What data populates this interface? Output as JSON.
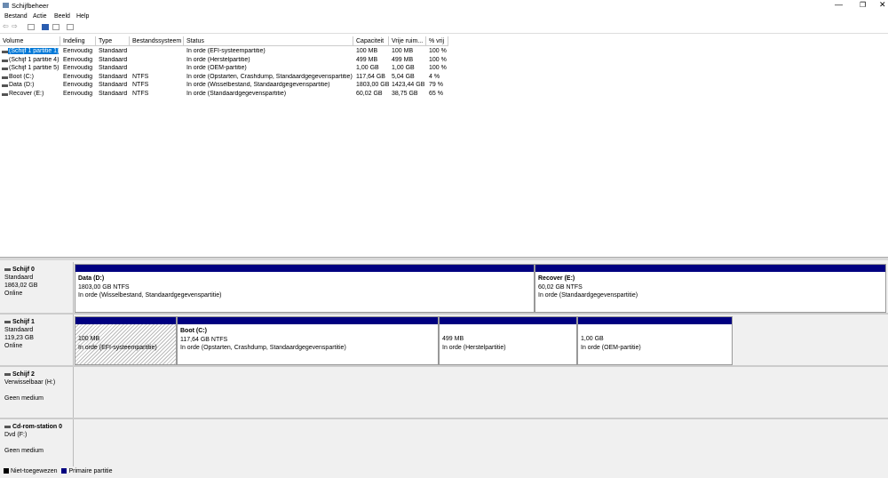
{
  "window": {
    "title": "Schijfbeheer"
  },
  "menu": [
    "Bestand",
    "Actie",
    "Beeld",
    "Help"
  ],
  "columns": [
    "Volume",
    "Indeling",
    "Type",
    "Bestandssysteem",
    "Status",
    "Capaciteit",
    "Vrije ruim...",
    "% vrij"
  ],
  "volumes": [
    [
      "(Schijf 1 partitie 1)",
      "Eenvoudig",
      "Standaard",
      "",
      "In orde (EFI-systeempartitie)",
      "100 MB",
      "100 MB",
      "100 %"
    ],
    [
      "(Schijf 1 partitie 4)",
      "Eenvoudig",
      "Standaard",
      "",
      "In orde (Herstelpartitie)",
      "499 MB",
      "499 MB",
      "100 %"
    ],
    [
      "(Schijf 1 partitie 5)",
      "Eenvoudig",
      "Standaard",
      "",
      "In orde (OEM-partitie)",
      "1,00 GB",
      "1,00 GB",
      "100 %"
    ],
    [
      "Boot (C:)",
      "Eenvoudig",
      "Standaard",
      "NTFS",
      "In orde (Opstarten, Crashdump, Standaardgegevenspartitie)",
      "117,64 GB",
      "5,04 GB",
      "4 %"
    ],
    [
      "Data (D:)",
      "Eenvoudig",
      "Standaard",
      "NTFS",
      "In orde (Wisselbestand, Standaardgegevenspartitie)",
      "1803,00 GB",
      "1423,44 GB",
      "79 %"
    ],
    [
      "Recover (E:)",
      "Eenvoudig",
      "Standaard",
      "NTFS",
      "In orde (Standaardgegevenspartitie)",
      "60,02 GB",
      "38,75 GB",
      "65 %"
    ]
  ],
  "disks": [
    {
      "name": "Schijf 0",
      "type": "Standaard",
      "size": "1863,02 GB",
      "state": "Online",
      "partitions": [
        {
          "title": "Data  (D:)",
          "size": "1803,00 GB NTFS",
          "status": "In orde (Wisselbestand, Standaardgegevenspartitie)"
        },
        {
          "title": "Recover  (E:)",
          "size": "60,02 GB NTFS",
          "status": "In orde (Standaardgegevenspartitie)"
        }
      ]
    },
    {
      "name": "Schijf 1",
      "type": "Standaard",
      "size": "119,23 GB",
      "state": "Online",
      "partitions": [
        {
          "title": "",
          "size": "100 MB",
          "status": "In orde (EFI-systeempartitie)"
        },
        {
          "title": "Boot  (C:)",
          "size": "117,64 GB NTFS",
          "status": "In orde (Opstarten, Crashdump, Standaardgegevenspartitie)"
        },
        {
          "title": "",
          "size": "499 MB",
          "status": "In orde (Herstelpartitie)"
        },
        {
          "title": "",
          "size": "1,00 GB",
          "status": "In orde (OEM-partitie)"
        }
      ]
    },
    {
      "name": "Schijf 2",
      "type": "Verwisselbaar (H:)",
      "state": "Geen medium"
    },
    {
      "name": "Cd-rom-station 0",
      "type": "Dvd (F:)",
      "state": "Geen medium"
    }
  ],
  "legend": [
    {
      "label": "Niet-toegewezen",
      "color": "#000000"
    },
    {
      "label": "Primaire partitie",
      "color": "#000080"
    }
  ]
}
